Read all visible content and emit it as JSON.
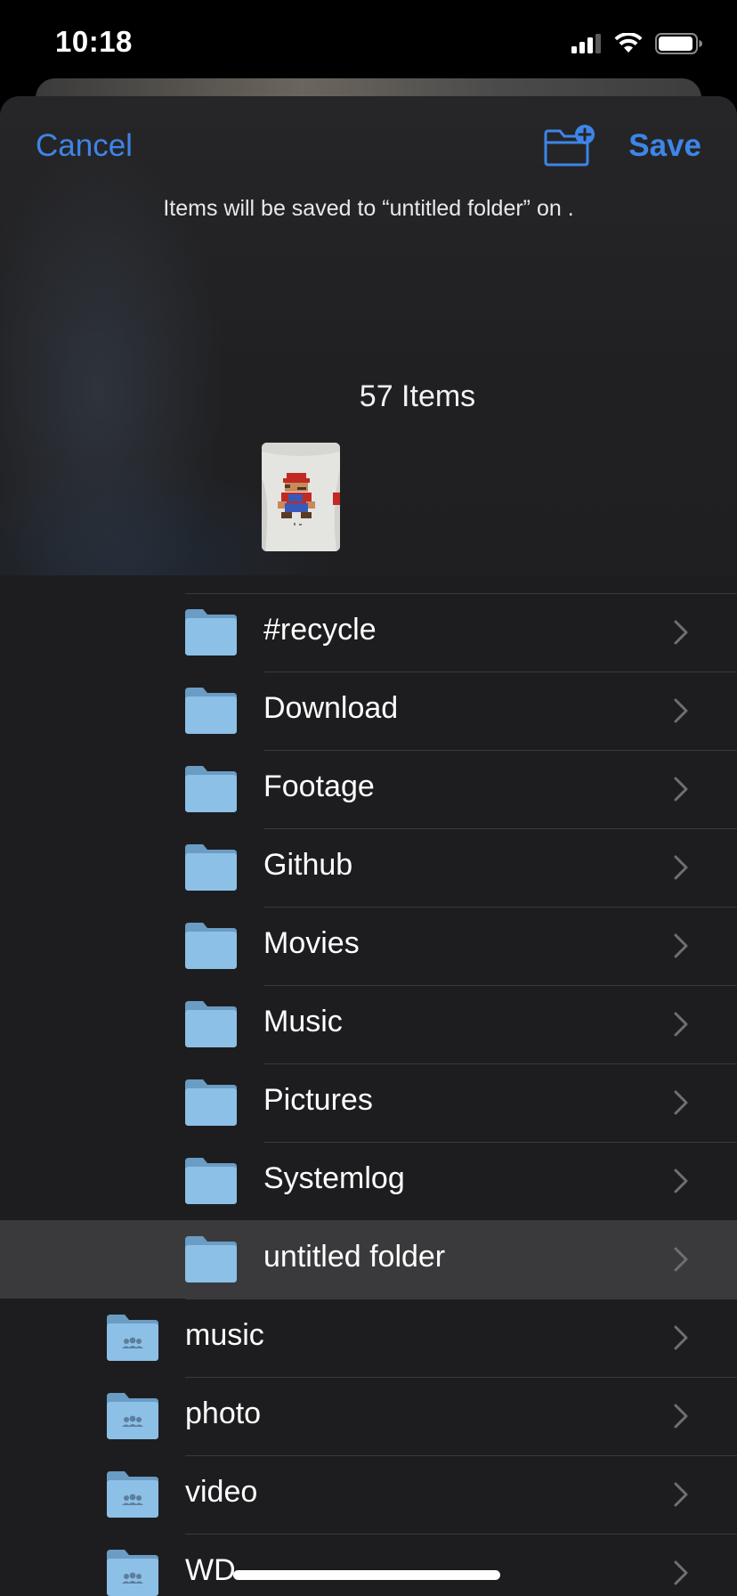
{
  "status_bar": {
    "time": "10:18",
    "icons": [
      "cellular-signal-icon",
      "wifi-icon",
      "battery-icon"
    ]
  },
  "header": {
    "cancel_label": "Cancel",
    "save_label": "Save",
    "new_folder_icon": "folder-plus-icon",
    "save_info": "Items will be saved to “untitled folder” on .",
    "items_count": "57 Items"
  },
  "folders": {
    "subfolders": [
      {
        "name": "#recycle",
        "selected": false
      },
      {
        "name": "Download",
        "selected": false
      },
      {
        "name": "Footage",
        "selected": false
      },
      {
        "name": "Github",
        "selected": false
      },
      {
        "name": "Movies",
        "selected": false
      },
      {
        "name": "Music",
        "selected": false
      },
      {
        "name": "Pictures",
        "selected": false
      },
      {
        "name": "Systemlog",
        "selected": false
      },
      {
        "name": "untitled folder",
        "selected": true
      }
    ],
    "shared": [
      {
        "name": "music"
      },
      {
        "name": "photo"
      },
      {
        "name": "video"
      },
      {
        "name": "WD"
      }
    ]
  },
  "colors": {
    "accent": "#3d85e8",
    "sheet_background": "#1d1d1f",
    "selected_row": "#3a3a3c",
    "folder": "#8cc0e6"
  }
}
